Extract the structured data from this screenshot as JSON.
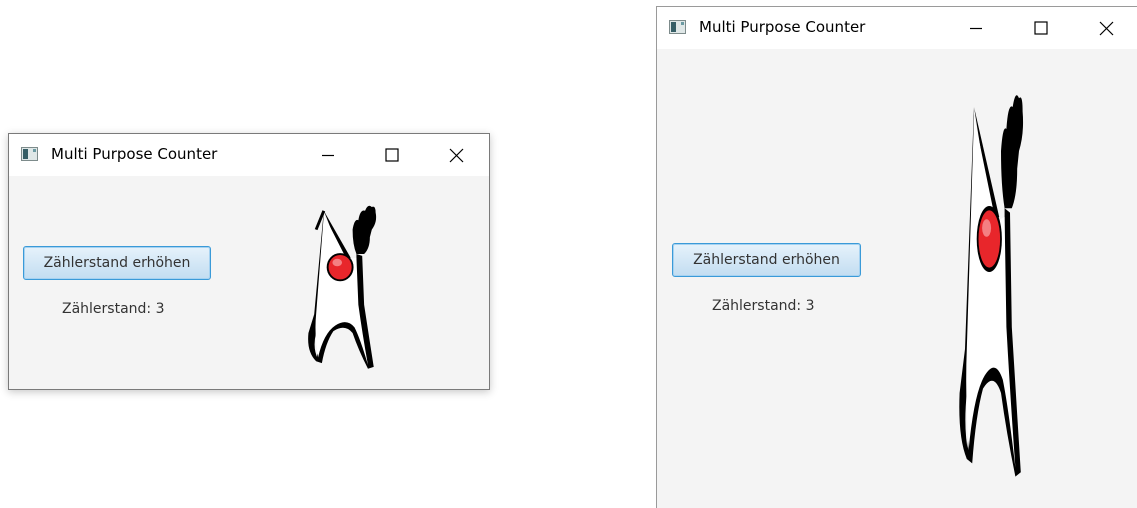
{
  "windows": [
    {
      "id": "small",
      "title": "Multi Purpose Counter",
      "button_label": "Zählerstand erhöhen",
      "counter_text": "Zählerstand: 3"
    },
    {
      "id": "large",
      "title": "Multi Purpose Counter",
      "button_label": "Zählerstand erhöhen",
      "counter_text": "Zählerstand: 3"
    }
  ],
  "icons": {
    "app": "app-window-icon",
    "minimize": "minimize-icon",
    "maximize": "maximize-icon",
    "close": "close-icon",
    "mascot": "duke-mascot-image"
  },
  "colors": {
    "button_border": "#3a9ad8",
    "window_bg": "#f4f4f4",
    "titlebar_bg": "#ffffff",
    "duke_nose": "#e8262b"
  }
}
